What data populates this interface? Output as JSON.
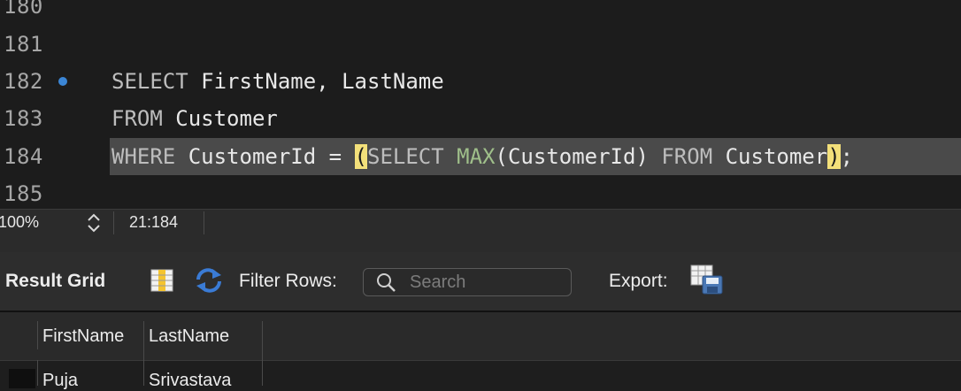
{
  "editor": {
    "lines": [
      {
        "num": "180",
        "tokens": []
      },
      {
        "num": "181",
        "tokens": []
      },
      {
        "num": "182",
        "marker": true,
        "tokens": [
          {
            "t": "SELECT",
            "c": "kw"
          },
          {
            "t": " FirstName, LastName",
            "c": ""
          }
        ]
      },
      {
        "num": "183",
        "tokens": [
          {
            "t": "FROM",
            "c": "kw"
          },
          {
            "t": " Customer",
            "c": ""
          }
        ]
      },
      {
        "num": "184",
        "highlight": true,
        "tokens": [
          {
            "t": "WHERE",
            "c": "kw"
          },
          {
            "t": " CustomerId = ",
            "c": ""
          },
          {
            "t": "(",
            "c": "bm"
          },
          {
            "t": "SELECT",
            "c": "kw"
          },
          {
            "t": " ",
            "c": ""
          },
          {
            "t": "MAX",
            "c": "fn"
          },
          {
            "t": "(CustomerId) ",
            "c": ""
          },
          {
            "t": "FROM",
            "c": "kw"
          },
          {
            "t": " Customer",
            "c": ""
          },
          {
            "t": ")",
            "c": "bm"
          },
          {
            "t": ";",
            "c": ""
          }
        ]
      },
      {
        "num": "185",
        "tokens": []
      }
    ]
  },
  "status": {
    "zoom": "100%",
    "cursor": "21:184"
  },
  "result_toolbar": {
    "title": "Result Grid",
    "filter_label": "Filter Rows:",
    "search_placeholder": "Search",
    "export_label": "Export:"
  },
  "grid": {
    "columns": [
      "FirstName",
      "LastName"
    ],
    "rows": [
      [
        "Puja",
        "Srivastava"
      ]
    ]
  },
  "colors": {
    "marker": "#3b86d6",
    "bracket_match": "#f3e07a",
    "function": "#9fbf8a",
    "line_highlight": "#4a4a4a"
  },
  "icons": [
    "breakpoint-marker-icon",
    "stepper-icon",
    "result-grid-icon",
    "refresh-icon",
    "search-icon",
    "export-icon"
  ]
}
